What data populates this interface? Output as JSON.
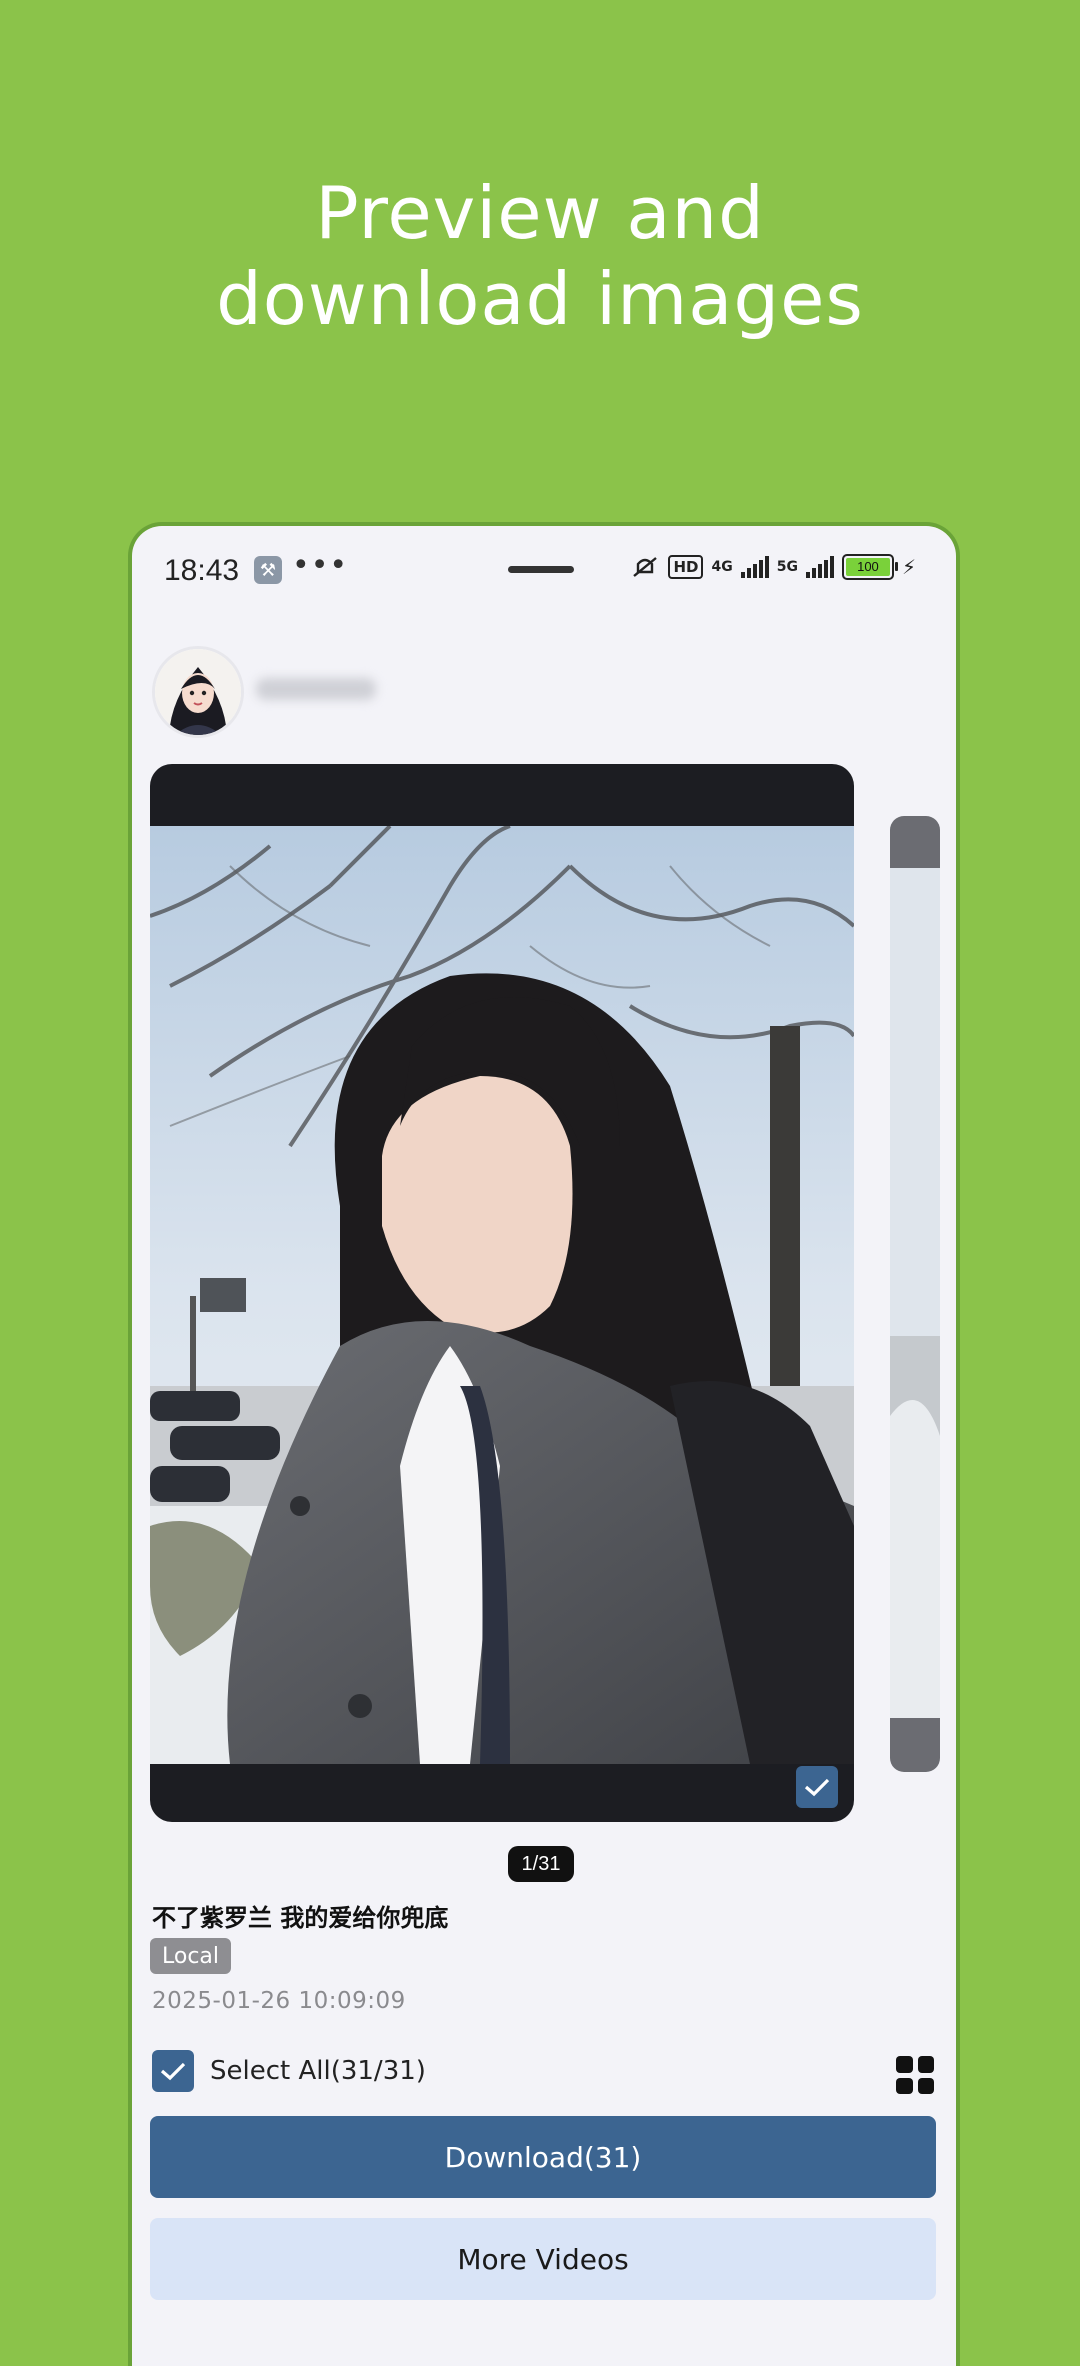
{
  "headline": {
    "line1": "Preview and",
    "line2": "download images"
  },
  "status_bar": {
    "time": "18:43",
    "dots": "•••",
    "hd_label": "HD",
    "net1": "4G",
    "net2": "5G",
    "battery": "100"
  },
  "profile": {
    "username": "██████"
  },
  "viewer": {
    "counter": "1/31",
    "post_title": "不了紫罗兰 我的爱给你兜底",
    "source_tag": "Local",
    "timestamp": "2025-01-26 10:09:09"
  },
  "selection": {
    "select_all_label": "Select All(31/31)"
  },
  "actions": {
    "download_label": "Download(31)",
    "more_label": "More Videos"
  },
  "colors": {
    "background": "#8bc34a",
    "accent": "#3c6591",
    "secondary_button": "#d9e4f7"
  },
  "icons": [
    "wrench-icon",
    "mute-icon",
    "signal-icon",
    "battery-icon",
    "charging-icon",
    "checkbox-icon",
    "grid-view-icon"
  ]
}
